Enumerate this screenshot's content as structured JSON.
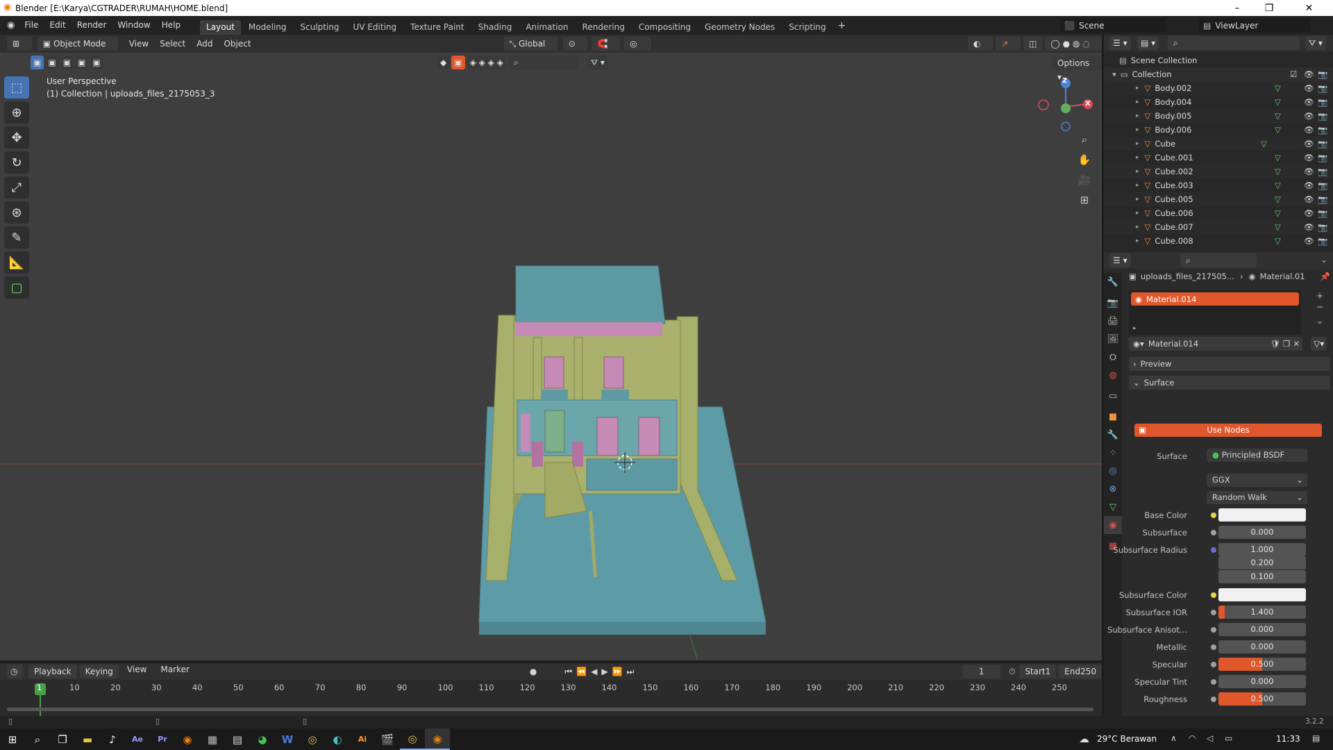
{
  "window": {
    "title": "Blender [E:\\Karya\\CGTRADER\\RUMAH\\HOME.blend]"
  },
  "menus": [
    "File",
    "Edit",
    "Render",
    "Window",
    "Help"
  ],
  "workspaces": [
    "Layout",
    "Modeling",
    "Sculpting",
    "UV Editing",
    "Texture Paint",
    "Shading",
    "Animation",
    "Rendering",
    "Compositing",
    "Geometry Nodes",
    "Scripting"
  ],
  "active_workspace": "Layout",
  "scene_name": "Scene",
  "view_layer": "ViewLayer",
  "viewport": {
    "mode": "Object Mode",
    "header_menus": [
      "View",
      "Select",
      "Add",
      "Object"
    ],
    "transform": "Global",
    "options_label": "Options",
    "overlay_line1": "User Perspective",
    "overlay_line2": "(1) Collection | uploads_files_2175053_3"
  },
  "gizmo": {
    "z": "Z",
    "x": "X"
  },
  "outliner": {
    "scene_collection": "Scene Collection",
    "collection": "Collection",
    "items": [
      "Body.002",
      "Body.004",
      "Body.005",
      "Body.006",
      "Cube",
      "Cube.001",
      "Cube.002",
      "Cube.003",
      "Cube.005",
      "Cube.006",
      "Cube.007",
      "Cube.008"
    ]
  },
  "properties": {
    "breadcrumb_object": "uploads_files_217505...",
    "breadcrumb_material": "Material.01",
    "slot": "Material.014",
    "material_name": "Material.014",
    "panel_preview": "Preview",
    "panel_surface": "Surface",
    "use_nodes": "Use Nodes",
    "surface_label": "Surface",
    "surface_value": "Principled BSDF",
    "distribution": "GGX",
    "subsurface_method": "Random Walk",
    "fields": [
      {
        "label": "Base Color",
        "value": ""
      },
      {
        "label": "Subsurface",
        "value": "0.000"
      },
      {
        "label": "Subsurface Radius",
        "value": "1.000"
      },
      {
        "label": "",
        "value": "0.200"
      },
      {
        "label": "",
        "value": "0.100"
      },
      {
        "label": "Subsurface Color",
        "value": ""
      },
      {
        "label": "Subsurface IOR",
        "value": "1.400"
      },
      {
        "label": "Subsurface Anisot...",
        "value": "0.000"
      },
      {
        "label": "Metallic",
        "value": "0.000"
      },
      {
        "label": "Specular",
        "value": "0.500"
      },
      {
        "label": "Specular Tint",
        "value": "0.000"
      },
      {
        "label": "Roughness",
        "value": "0.500"
      }
    ]
  },
  "timeline": {
    "menus": [
      "Playback",
      "Keying",
      "View",
      "Marker"
    ],
    "current_frame": "1",
    "start_label": "Start",
    "start": "1",
    "end_label": "End",
    "end": "250",
    "ticks": [
      "1",
      "10",
      "20",
      "30",
      "40",
      "50",
      "60",
      "70",
      "80",
      "90",
      "100",
      "110",
      "120",
      "130",
      "140",
      "150",
      "160",
      "170",
      "180",
      "190",
      "200",
      "210",
      "220",
      "230",
      "240",
      "250"
    ]
  },
  "version": "3.2.2",
  "taskbar": {
    "weather": "29°C Berawan",
    "time": "11:33"
  },
  "colors": {
    "accent": "#4772b3",
    "material_active": "#e0572b",
    "orange_slider": "#e0572b"
  }
}
